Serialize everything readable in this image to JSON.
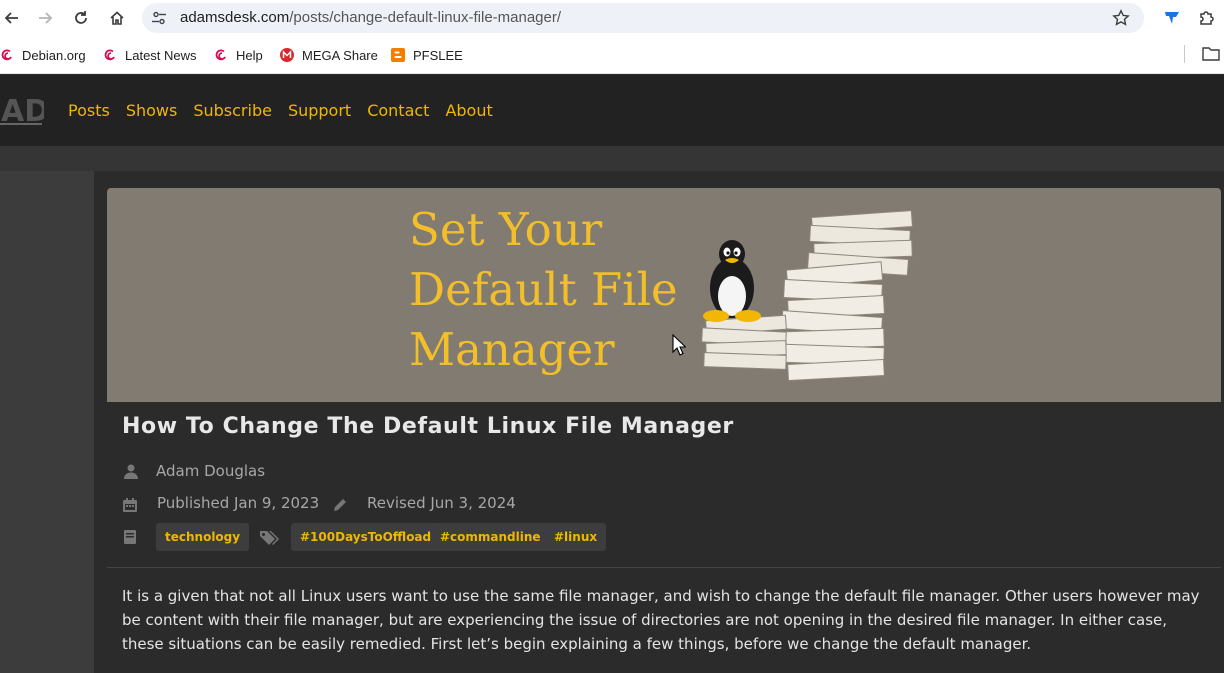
{
  "browser": {
    "url_host": "adamsdesk.com",
    "url_path": "/posts/change-default-linux-file-manager/",
    "bookmarks": [
      {
        "label": "Debian.org",
        "icon": "debian-swirl-icon"
      },
      {
        "label": "Latest News",
        "icon": "debian-swirl-icon"
      },
      {
        "label": "Help",
        "icon": "debian-swirl-icon"
      },
      {
        "label": "MEGA Share",
        "icon": "mega-icon"
      },
      {
        "label": "PFSLEE",
        "icon": "blogger-icon"
      }
    ]
  },
  "site": {
    "logo_text": "AD",
    "nav": [
      "Posts",
      "Shows",
      "Subscribe",
      "Support",
      "Contact",
      "About"
    ]
  },
  "hero": {
    "line1": "Set Your",
    "line2": "Default File",
    "line3": "Manager"
  },
  "article": {
    "title": "How To Change The Default Linux File Manager",
    "author": "Adam Douglas",
    "published": "Published Jan 9, 2023",
    "revised": "Revised Jun 3, 2024",
    "category": "technology",
    "tags": [
      "#100DaysToOffload",
      "#commandline",
      "#linux"
    ],
    "intro": "It is a given that not all Linux users want to use the same file manager, and wish to change the default file manager. Other users however may be content with their file manager, but are experiencing the issue of directories are not opening in the desired file manager. In either case, these situations can be easily remedied. First let’s begin explaining a few things, before we change the default manager."
  },
  "colors": {
    "accent": "#f0b700",
    "hero_bg": "#817b72",
    "hero_title": "#f2bf2a",
    "header_bg": "#222222"
  }
}
